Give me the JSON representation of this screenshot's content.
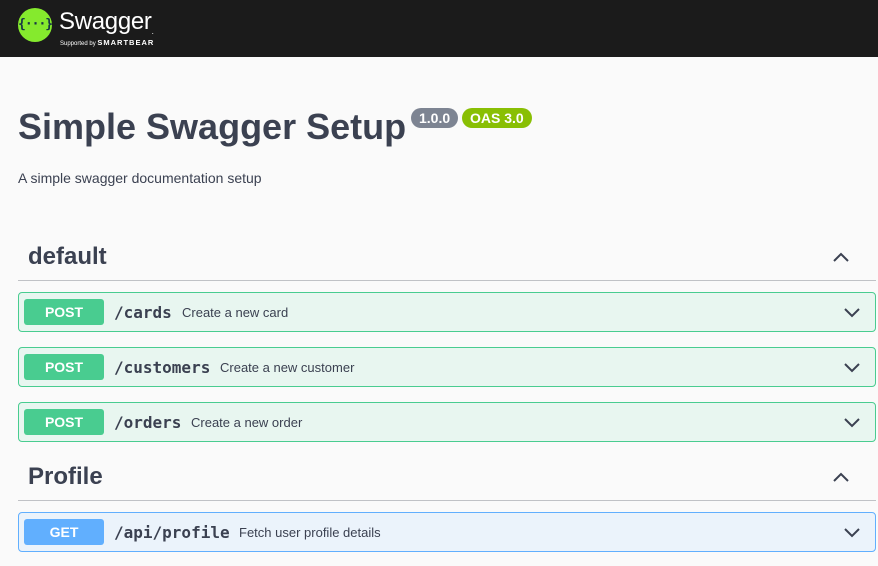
{
  "topbar": {
    "brand": "Swagger",
    "tm": ".",
    "supported_by": "Supported by",
    "company": "SMARTBEAR",
    "logo_glyph": "{···}",
    "logo_icon": "swagger-logo-icon",
    "colors": {
      "bar": "#1b1b1b",
      "logo": "#85ea2d"
    }
  },
  "info": {
    "title": "Simple Swagger Setup",
    "version": "1.0.0",
    "oas": "OAS 3.0",
    "description": "A simple swagger documentation setup"
  },
  "sections": [
    {
      "name": "default",
      "expanded": true,
      "toggle_icon": "chevron-up-icon",
      "operations": [
        {
          "method": "POST",
          "path": "/cards",
          "summary": "Create a new card",
          "icon": "chevron-down-icon"
        },
        {
          "method": "POST",
          "path": "/customers",
          "summary": "Create a new customer",
          "icon": "chevron-down-icon"
        },
        {
          "method": "POST",
          "path": "/orders",
          "summary": "Create a new order",
          "icon": "chevron-down-icon"
        }
      ]
    },
    {
      "name": "Profile",
      "expanded": true,
      "toggle_icon": "chevron-up-icon",
      "operations": [
        {
          "method": "GET",
          "path": "/api/profile",
          "summary": "Fetch user profile details",
          "icon": "chevron-down-icon"
        }
      ]
    }
  ],
  "colors": {
    "post": "#49cc90",
    "get": "#61affe",
    "version_badge": "#7d8492",
    "oas_badge": "#89bf04",
    "text": "#3b4151"
  }
}
